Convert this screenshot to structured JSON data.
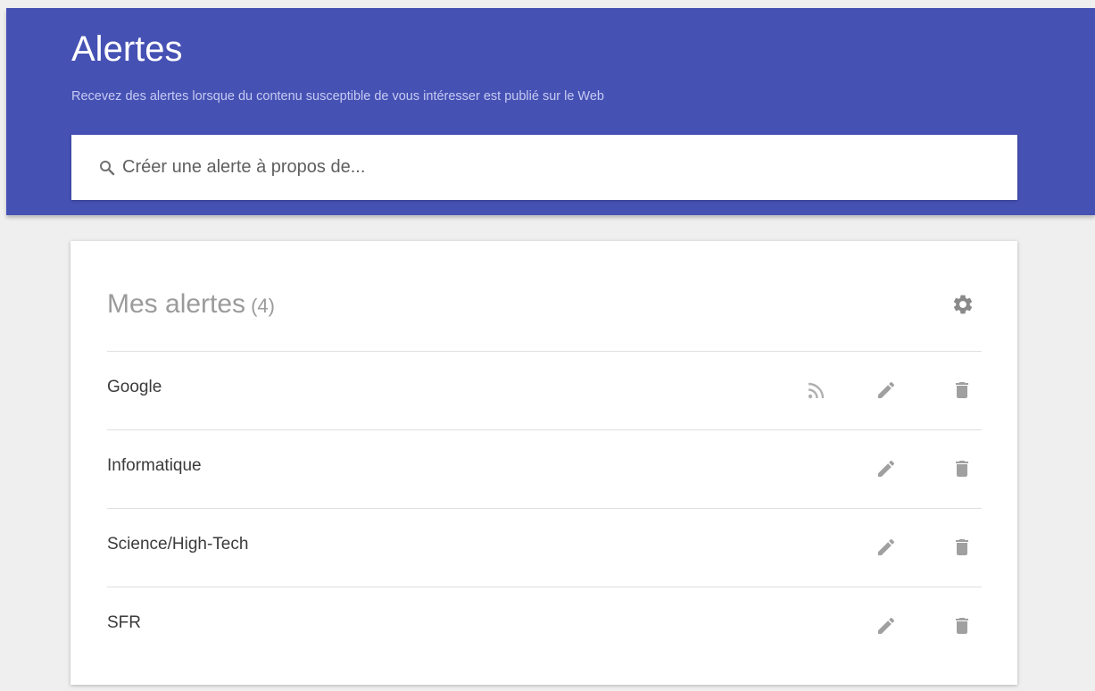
{
  "header": {
    "title": "Alertes",
    "subtitle": "Recevez des alertes lorsque du contenu susceptible de vous intéresser est publié sur le Web"
  },
  "search": {
    "placeholder": "Créer une alerte à propos de...",
    "value": "",
    "icon": "search-icon"
  },
  "alerts_card": {
    "title": "Mes alertes",
    "count": "(4)",
    "settings_icon": "gear-icon",
    "items": [
      {
        "name": "Google",
        "has_rss": true
      },
      {
        "name": "Informatique",
        "has_rss": false
      },
      {
        "name": "Science/High-Tech",
        "has_rss": false
      },
      {
        "name": "SFR",
        "has_rss": false
      }
    ]
  },
  "colors": {
    "header_bg": "#4651b4",
    "page_bg": "#efefef",
    "icon_gray": "#9e9e9e"
  }
}
